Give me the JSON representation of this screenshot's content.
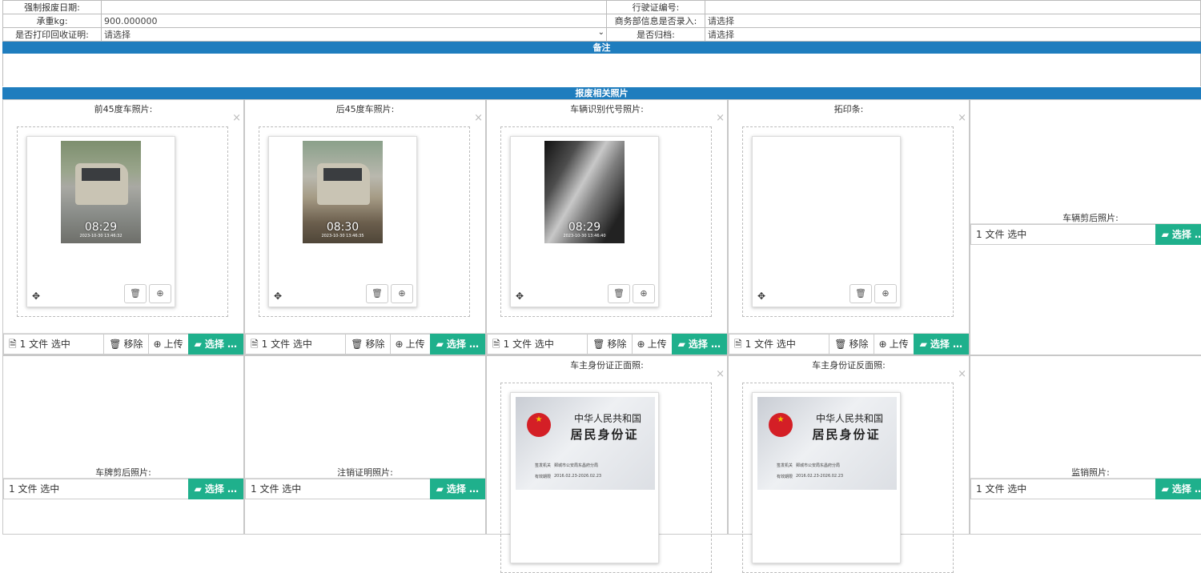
{
  "form": {
    "rows": [
      {
        "l1": "强制报废日期:",
        "v1": "",
        "l2": "行驶证编号:",
        "v2": ""
      },
      {
        "l1": "承重kg:",
        "v1": "900.000000",
        "l2": "商务部信息是否录入:",
        "v2": "请选择"
      },
      {
        "l1": "是否打印回收证明:",
        "v1": "请选择",
        "l2": "是否归档:",
        "v2": "请选择"
      }
    ]
  },
  "sections": {
    "memo": "备注",
    "photos": "报废相关照片"
  },
  "upload_cells": [
    {
      "title": "前45度车照片:",
      "caption": "1 文件 选中",
      "ts": "08:29",
      "ts_sub": "2023-10-30 13:46:32"
    },
    {
      "title": "后45度车照片:",
      "caption": "1 文件 选中",
      "ts": "08:30",
      "ts_sub": "2023-10-30 13:46:35"
    },
    {
      "title": "车辆识别代号照片:",
      "caption": "1 文件 选中",
      "ts": "08:29",
      "ts_sub": "2023-10-30 13:46:40"
    },
    {
      "title": "拓印条:",
      "caption": "1 文件 选中"
    },
    {
      "title": "车辆剪后照片:",
      "caption": "1 文件 选中"
    },
    {
      "title": "车牌剪后照片:",
      "caption": "1 文件 选中"
    },
    {
      "title": "注销证明照片:",
      "caption": "1 文件 选中"
    },
    {
      "title": "车主身份证正面照:"
    },
    {
      "title": "车主身份证反面照:"
    },
    {
      "title": "监销照片:",
      "caption": "1 文件 选中"
    }
  ],
  "buttons": {
    "remove": "移除",
    "upload": "上传",
    "choose": "选择 …"
  },
  "id_card": {
    "line1": "中华人民共和国",
    "line2": "居民身份证",
    "authority_label": "签发机关",
    "authority": "鄄城市公安局东昌府分局",
    "validity_label": "有效期限",
    "validity": "2016.02.23-2026.02.23"
  },
  "icons": {
    "file": "file-icon",
    "trash": "trash-icon",
    "upload": "upload-icon",
    "folder": "folder-open-icon",
    "move": "move-icon",
    "zoom": "zoom-icon",
    "close": "close-icon"
  },
  "colors": {
    "header_bar": "#1f7dbe",
    "choose_button": "#1fb08c"
  }
}
